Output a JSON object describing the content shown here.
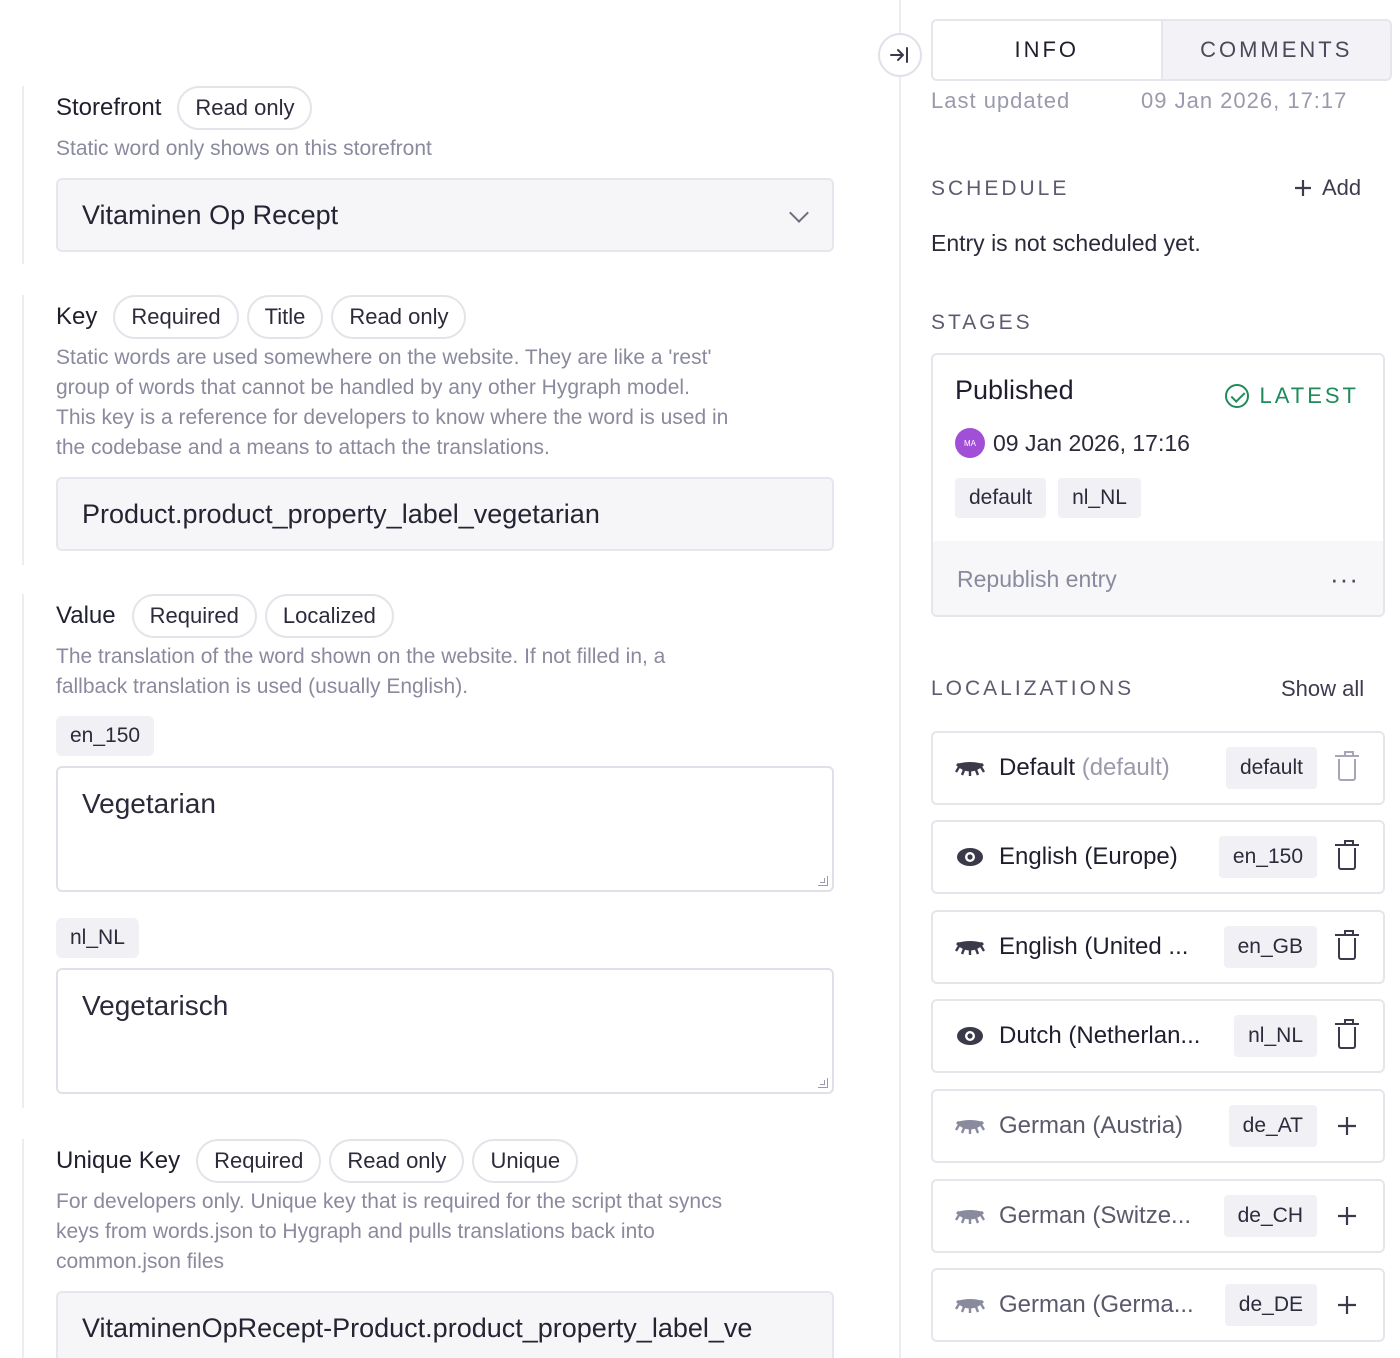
{
  "form": {
    "storefront": {
      "title": "Storefront",
      "badges": [
        "Read only"
      ],
      "help": "Static word only shows on this storefront",
      "value": "Vitaminen Op Recept"
    },
    "key": {
      "title": "Key",
      "badges": [
        "Required",
        "Title",
        "Read only"
      ],
      "help": [
        "Static words are used somewhere on the website. They are like a 'rest'",
        "group of words that cannot be handled by any other Hygraph model.",
        "This key is a reference for developers to know where the word is used in",
        "the codebase and a means to attach the translations."
      ],
      "value": "Product.product_property_label_vegetarian"
    },
    "value": {
      "title": "Value",
      "badges": [
        "Required",
        "Localized"
      ],
      "help": [
        "The translation of the word shown on the website. If not filled in, a",
        "fallback translation is used (usually English)."
      ],
      "locales": [
        {
          "code": "en_150",
          "text": "Vegetarian"
        },
        {
          "code": "nl_NL",
          "text": "Vegetarisch"
        }
      ]
    },
    "unique_key": {
      "title": "Unique Key",
      "badges": [
        "Required",
        "Read only",
        "Unique"
      ],
      "help": [
        "For developers only. Unique key that is required for the script that syncs",
        "keys from words.json to Hygraph and pulls translations back into",
        "common.json files"
      ],
      "value": "VitaminenOpRecept-Product.product_property_label_ve"
    }
  },
  "panel": {
    "tabs": [
      {
        "label": "INFO",
        "active": true
      },
      {
        "label": "COMMENTS",
        "active": false
      }
    ],
    "partial_row": {
      "label": "Last updated",
      "value": "09 Jan 2026, 17:17"
    },
    "schedule": {
      "label": "SCHEDULE",
      "add_label": "Add",
      "empty_text": "Entry is not scheduled yet."
    },
    "stages": {
      "label": "STAGES",
      "title": "Published",
      "badge": "LATEST",
      "avatar_initials": "MA",
      "date": "09 Jan 2026, 17:16",
      "tags": [
        "default",
        "nl_NL"
      ],
      "republish": "Republish entry",
      "more": "···"
    },
    "localizations": {
      "label": "LOCALIZATIONS",
      "show_all": "Show all",
      "items": [
        {
          "name": "Default",
          "sub": "(default)",
          "code": "default",
          "icon": "eye-closed-icon",
          "action": "delete",
          "dim": false
        },
        {
          "name": "English (Europe)",
          "sub": "",
          "code": "en_150",
          "icon": "eye-icon",
          "action": "delete",
          "dim": false
        },
        {
          "name": "English (United ...",
          "sub": "",
          "code": "en_GB",
          "icon": "eye-closed-icon",
          "action": "delete",
          "dim": false
        },
        {
          "name": "Dutch (Netherlan...",
          "sub": "",
          "code": "nl_NL",
          "icon": "eye-icon",
          "action": "delete",
          "dim": false
        },
        {
          "name": "German (Austria)",
          "sub": "",
          "code": "de_AT",
          "icon": "eye-closed-icon",
          "action": "add",
          "dim": true
        },
        {
          "name": "German (Switze...",
          "sub": "",
          "code": "de_CH",
          "icon": "eye-closed-icon",
          "action": "add",
          "dim": true
        },
        {
          "name": "German (Germa...",
          "sub": "",
          "code": "de_DE",
          "icon": "eye-closed-icon",
          "action": "add",
          "dim": true
        }
      ]
    }
  }
}
